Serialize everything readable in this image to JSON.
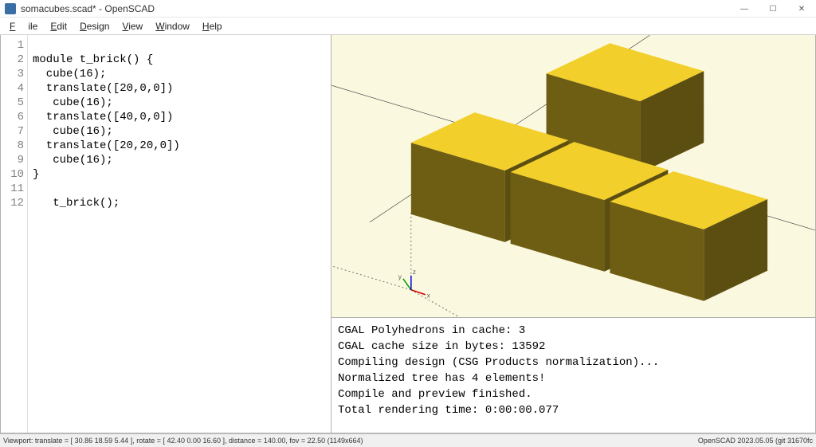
{
  "window": {
    "title": "somacubes.scad* - OpenSCAD",
    "min": "—",
    "max": "☐",
    "close": "✕"
  },
  "menu": {
    "file": "File",
    "edit": "Edit",
    "design": "Design",
    "view": "View",
    "window": "Window",
    "help": "Help"
  },
  "editor": {
    "gutter": [
      "1",
      "2",
      "3",
      "4",
      "5",
      "6",
      "7",
      "8",
      "9",
      "10",
      "11",
      "12"
    ],
    "lines": [
      "module t_brick() {",
      "  cube(16);",
      "  translate([20,0,0])",
      "   cube(16);",
      "  translate([40,0,0])",
      "   cube(16);",
      "  translate([20,20,0])",
      "   cube(16);",
      "}",
      "",
      "   t_brick();",
      ""
    ]
  },
  "console": {
    "lines": [
      "CGAL Polyhedrons in cache: 3",
      "CGAL cache size in bytes: 13592",
      "Compiling design (CSG Products normalization)...",
      "Normalized tree has 4 elements!",
      "Compile and preview finished.",
      "Total rendering time: 0:00:00.077"
    ]
  },
  "statusbar": {
    "left": "Viewport: translate = [ 30.86 18.59 5.44 ], rotate = [ 42.40 0.00 16.60 ], distance = 140.00, fov = 22.50 (1149x664)",
    "right": "OpenSCAD 2023.05.05 (git 31670fc"
  },
  "axis_labels": {
    "x": "x",
    "y": "y",
    "z": "z"
  }
}
